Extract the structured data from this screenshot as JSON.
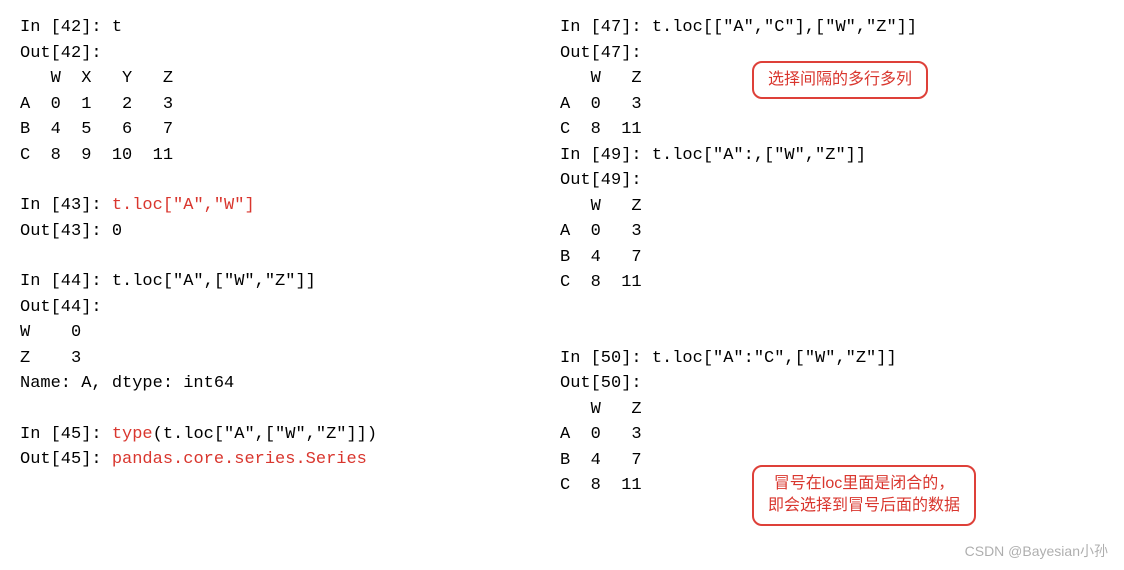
{
  "left": {
    "lines": [
      {
        "segments": [
          {
            "t": "In [42]: t"
          }
        ]
      },
      {
        "segments": [
          {
            "t": "Out[42]:"
          }
        ]
      },
      {
        "segments": [
          {
            "t": "   W  X   Y   Z"
          }
        ]
      },
      {
        "segments": [
          {
            "t": "A  0  1   2   3"
          }
        ]
      },
      {
        "segments": [
          {
            "t": "B  4  5   6   7"
          }
        ]
      },
      {
        "segments": [
          {
            "t": "C  8  9  10  11"
          }
        ]
      },
      {
        "blank": true
      },
      {
        "segments": [
          {
            "t": "In [43]: "
          },
          {
            "t": "t.loc[\"A\",\"W\"]",
            "red": true
          }
        ]
      },
      {
        "segments": [
          {
            "t": "Out[43]: 0"
          }
        ]
      },
      {
        "blank": true
      },
      {
        "segments": [
          {
            "t": "In [44]: t.loc[\"A\",[\"W\",\"Z\"]]"
          }
        ]
      },
      {
        "segments": [
          {
            "t": "Out[44]:"
          }
        ]
      },
      {
        "segments": [
          {
            "t": "W    0"
          }
        ]
      },
      {
        "segments": [
          {
            "t": "Z    3"
          }
        ]
      },
      {
        "segments": [
          {
            "t": "Name: A, dtype: int64"
          }
        ]
      },
      {
        "blank": true
      },
      {
        "segments": [
          {
            "t": "In [45]: "
          },
          {
            "t": "type",
            "red": true
          },
          {
            "t": "(t.loc[\"A\",[\"W\",\"Z\"]])"
          }
        ]
      },
      {
        "segments": [
          {
            "t": "Out[45]: "
          },
          {
            "t": "pandas.core.series.Series",
            "red": true
          }
        ]
      }
    ]
  },
  "right": {
    "lines": [
      {
        "segments": [
          {
            "t": "In [47]: t.loc[[\"A\",\"C\"],[\"W\",\"Z\"]]"
          }
        ]
      },
      {
        "segments": [
          {
            "t": "Out[47]:"
          }
        ]
      },
      {
        "segments": [
          {
            "t": "   W   Z"
          }
        ]
      },
      {
        "segments": [
          {
            "t": "A  0   3"
          }
        ]
      },
      {
        "segments": [
          {
            "t": "C  8  11"
          }
        ]
      },
      {
        "segments": [
          {
            "t": "In [49]: t.loc[\"A\":,[\"W\",\"Z\"]]"
          }
        ]
      },
      {
        "segments": [
          {
            "t": "Out[49]:"
          }
        ]
      },
      {
        "segments": [
          {
            "t": "   W   Z"
          }
        ]
      },
      {
        "segments": [
          {
            "t": "A  0   3"
          }
        ]
      },
      {
        "segments": [
          {
            "t": "B  4   7"
          }
        ]
      },
      {
        "segments": [
          {
            "t": "C  8  11"
          }
        ]
      },
      {
        "blank": true
      },
      {
        "blank": true
      },
      {
        "segments": [
          {
            "t": "In [50]: t.loc[\"A\":\"C\",[\"W\",\"Z\"]]"
          }
        ]
      },
      {
        "segments": [
          {
            "t": "Out[50]:"
          }
        ]
      },
      {
        "segments": [
          {
            "t": "   W   Z"
          }
        ]
      },
      {
        "segments": [
          {
            "t": "A  0   3"
          }
        ]
      },
      {
        "segments": [
          {
            "t": "B  4   7"
          }
        ]
      },
      {
        "segments": [
          {
            "t": "C  8  11"
          }
        ]
      }
    ]
  },
  "callouts": {
    "c1": "选择间隔的多行多列",
    "c2": "冒号在loc里面是闭合的，\n即会选择到冒号后面的数据"
  },
  "watermark": "CSDN @Bayesian小孙"
}
